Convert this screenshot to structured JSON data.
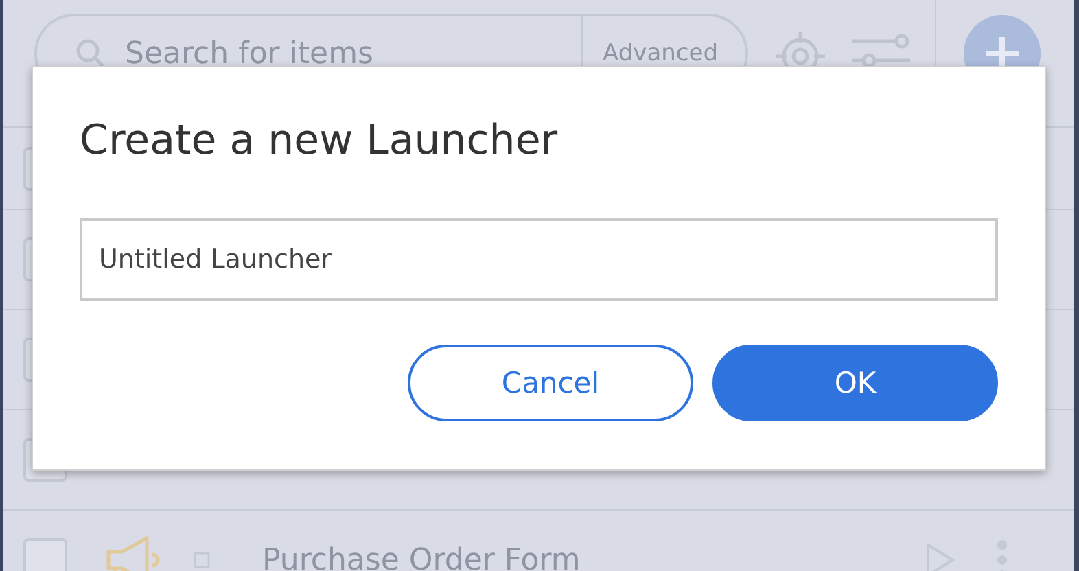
{
  "toolbar": {
    "search": {
      "placeholder": "Search for items"
    },
    "advanced_label": "Advanced"
  },
  "items": [
    {
      "checked": false
    },
    {
      "checked": false
    },
    {
      "checked": false
    },
    {
      "checked": false
    },
    {
      "title": "Purchase Order Form",
      "checked": false
    }
  ],
  "dialog": {
    "title": "Create a new Launcher",
    "name_field": {
      "value": "Untitled Launcher"
    },
    "buttons": [
      {
        "label": "Cancel",
        "kind": "secondary"
      },
      {
        "label": "OK",
        "kind": "primary"
      }
    ]
  }
}
